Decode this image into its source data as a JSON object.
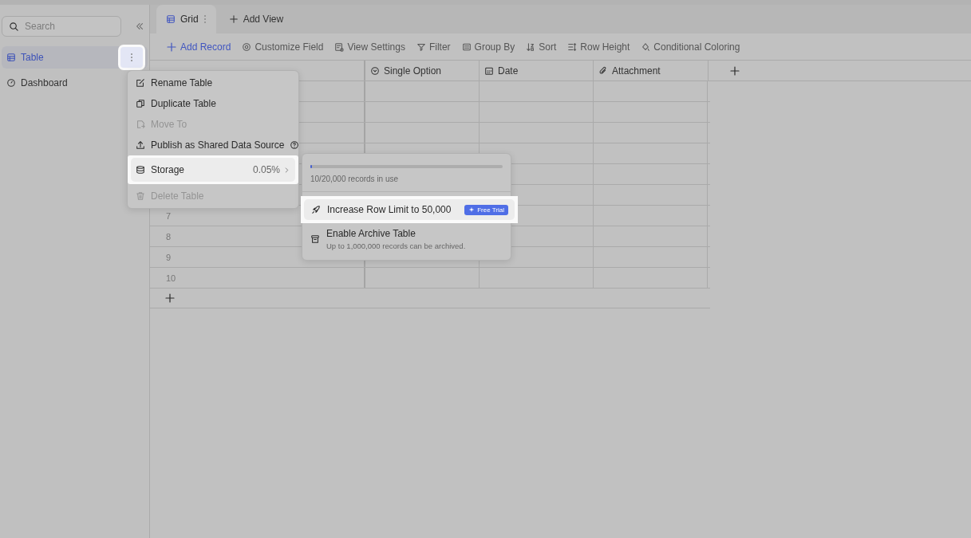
{
  "sidebar": {
    "search": {
      "placeholder": "Search"
    },
    "items": [
      {
        "label": "Table",
        "selected": true
      },
      {
        "label": "Dashboard",
        "selected": false
      }
    ]
  },
  "tabs": [
    {
      "label": "Grid",
      "selected": true
    },
    {
      "label": "Add View",
      "selected": false
    }
  ],
  "toolbar": [
    {
      "label": "Add Record",
      "primary": true
    },
    {
      "label": "Customize Field",
      "primary": false
    },
    {
      "label": "View Settings",
      "primary": false
    },
    {
      "label": "Filter",
      "primary": false
    },
    {
      "label": "Group By",
      "primary": false
    },
    {
      "label": "Sort",
      "primary": false
    },
    {
      "label": "Row Height",
      "primary": false
    },
    {
      "label": "Conditional Coloring",
      "primary": false
    }
  ],
  "table": {
    "columns": [
      {
        "label": "Single Option"
      },
      {
        "label": "Date"
      },
      {
        "label": "Attachment"
      }
    ],
    "rows": [
      {},
      {},
      {},
      {},
      {},
      {},
      {
        "number": "7"
      },
      {
        "number": "8"
      },
      {
        "number": "9"
      },
      {
        "number": "10"
      }
    ]
  },
  "context_menu": {
    "items": [
      {
        "label": "Rename Table",
        "disabled": false,
        "highlighted": false
      },
      {
        "label": "Duplicate Table",
        "disabled": false,
        "highlighted": false
      },
      {
        "label": "Move To",
        "disabled": true,
        "highlighted": false
      },
      {
        "label": "Publish as Shared Data Source",
        "disabled": false,
        "help": true,
        "highlighted": false
      },
      {
        "label": "Storage",
        "disabled": false,
        "value": "0.05%",
        "highlighted": true
      },
      {
        "label": "Delete Table",
        "disabled": true,
        "highlighted": false
      }
    ]
  },
  "storage_submenu": {
    "level": 0.0005,
    "usage": "10/20,000 records in use",
    "items": [
      {
        "label": "Increase Row Limit to 50,000",
        "badge": "Free Trial",
        "highlighted": true
      },
      {
        "label": "Enable Archive Table",
        "description": "Up to 1,000,000 records can be archived.",
        "highlighted": false
      }
    ]
  }
}
